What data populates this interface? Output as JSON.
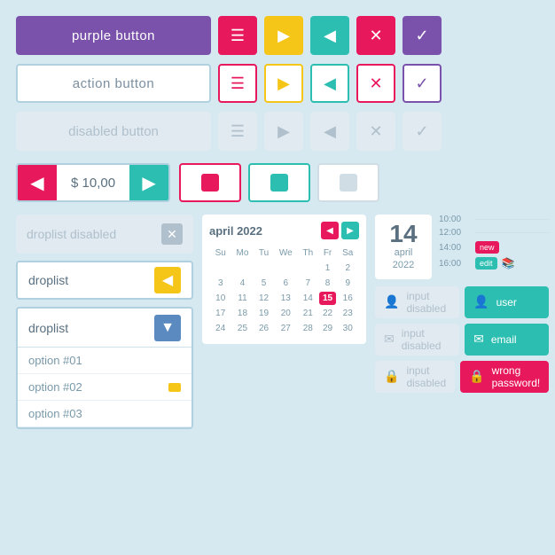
{
  "buttons": {
    "purple_label": "purple button",
    "action_label": "action button",
    "disabled_label": "disabled button",
    "stepper_value": "$ 10,00"
  },
  "icons": {
    "hamburger": "☰",
    "play": "▶",
    "back": "◀",
    "close": "✕",
    "check": "✓",
    "arrow_down": "▼",
    "arrow_left": "◀"
  },
  "droplists": {
    "disabled_label": "droplist disabled",
    "yellow_label": "droplist",
    "blue_label": "droplist",
    "option1": "option #01",
    "option2": "option #02",
    "option3": "option #03"
  },
  "calendar": {
    "title": "april 2022",
    "days": [
      "Su",
      "Mo",
      "Tu",
      "We",
      "Th",
      "Fr",
      "Sa"
    ],
    "weeks": [
      [
        "",
        "",
        "",
        "",
        "",
        "1",
        "2"
      ],
      [
        "3",
        "4",
        "5",
        "6",
        "7",
        "8",
        "9"
      ],
      [
        "10",
        "11",
        "12",
        "13",
        "14",
        "15",
        "16"
      ],
      [
        "17",
        "18",
        "19",
        "20",
        "21",
        "22",
        "23"
      ],
      [
        "24",
        "25",
        "26",
        "27",
        "28",
        "29",
        "30"
      ]
    ],
    "today": "15"
  },
  "date_display": {
    "day": "14",
    "month": "april",
    "year": "2022"
  },
  "schedule": {
    "times": [
      "10:00",
      "12:00",
      "14:00",
      "16:00"
    ],
    "new_label": "new",
    "edit_label": "edit"
  },
  "inputs": {
    "disabled_placeholder": "input disabled",
    "user_label": "user",
    "email_label": "email",
    "wrong_label": "wrong password!"
  }
}
